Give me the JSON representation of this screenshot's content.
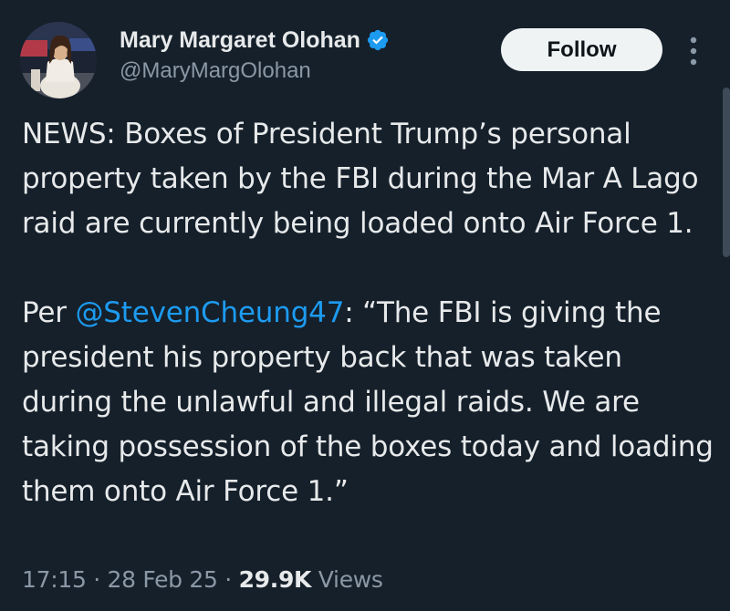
{
  "author": {
    "display_name": "Mary Margaret Olohan",
    "handle": "@MaryMargOlohan",
    "verified": true,
    "verified_color": "#1d9bf0"
  },
  "actions": {
    "follow_label": "Follow",
    "more_icon": "more-vertical-icon"
  },
  "tweet": {
    "paragraph1": "NEWS: Boxes of President Trump’s personal property taken by the FBI during the Mar A Lago raid are currently being loaded onto Air Force 1.",
    "p2_prefix": "Per ",
    "mention": "@StevenCheung47",
    "p2_rest": ": “The FBI is giving the president his property back that was taken during the unlawful and illegal raids. We are taking possession of the boxes today and loading them onto Air Force 1.”"
  },
  "meta": {
    "time": "17:15",
    "separator": "·",
    "date": "28 Feb 25",
    "views_count": "29.9K",
    "views_label": "Views"
  },
  "colors": {
    "background": "#15202b",
    "text": "#e7e9ea",
    "secondary": "#8b98a5",
    "link": "#1d9bf0"
  }
}
